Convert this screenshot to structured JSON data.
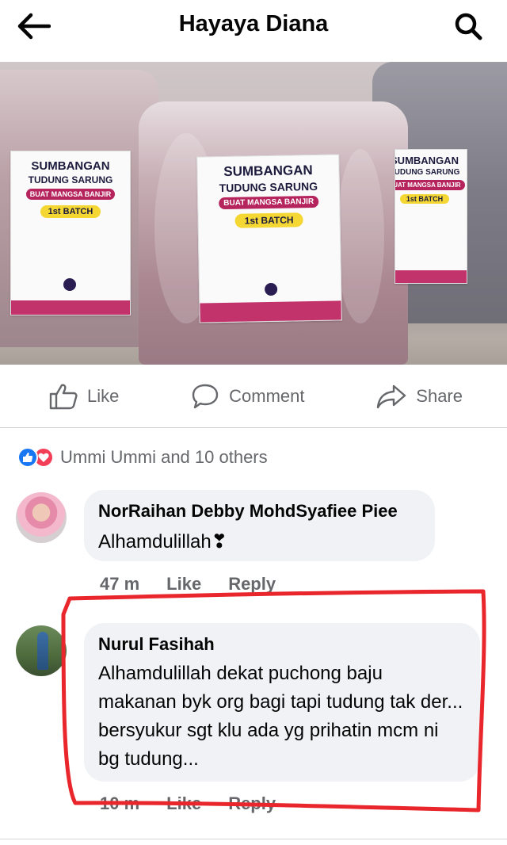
{
  "header": {
    "title": "Hayaya Diana"
  },
  "post_image": {
    "labels": [
      {
        "line1": "SUMBANGAN",
        "line2": "TUDUNG SARUNG",
        "line3": "BUAT MANGSA BANJIR",
        "line4": "1st BATCH"
      },
      {
        "line1": "SUMBANGAN",
        "line2": "TUDUNG SARUNG",
        "line3": "BUAT MANGSA BANJIR",
        "line4": "1st BATCH"
      },
      {
        "line1": "SUMBANGAN",
        "line2": "TUDUNG SARUNG",
        "line3": "BUAT MANGSA BANJIR",
        "line4": "1st BATCH"
      }
    ]
  },
  "actions": {
    "like": "Like",
    "comment": "Comment",
    "share": "Share"
  },
  "reactions": {
    "text": "Ummi Ummi and 10 others"
  },
  "comments": [
    {
      "author": "NorRaihan Debby MohdSyafiee Piee",
      "text": "Alhamdulillah❣",
      "time": "47 m",
      "like": "Like",
      "reply": "Reply"
    },
    {
      "author": "Nurul Fasihah",
      "text": "Alhamdulillah dekat puchong baju makanan byk org bagi tapi tudung tak der... bersyukur sgt klu ada yg prihatin mcm ni bg tudung...",
      "time": "10 m",
      "like": "Like",
      "reply": "Reply"
    }
  ],
  "colors": {
    "highlight": "#e8262b",
    "like_blue": "#1877f2",
    "love_red": "#f33e58"
  }
}
